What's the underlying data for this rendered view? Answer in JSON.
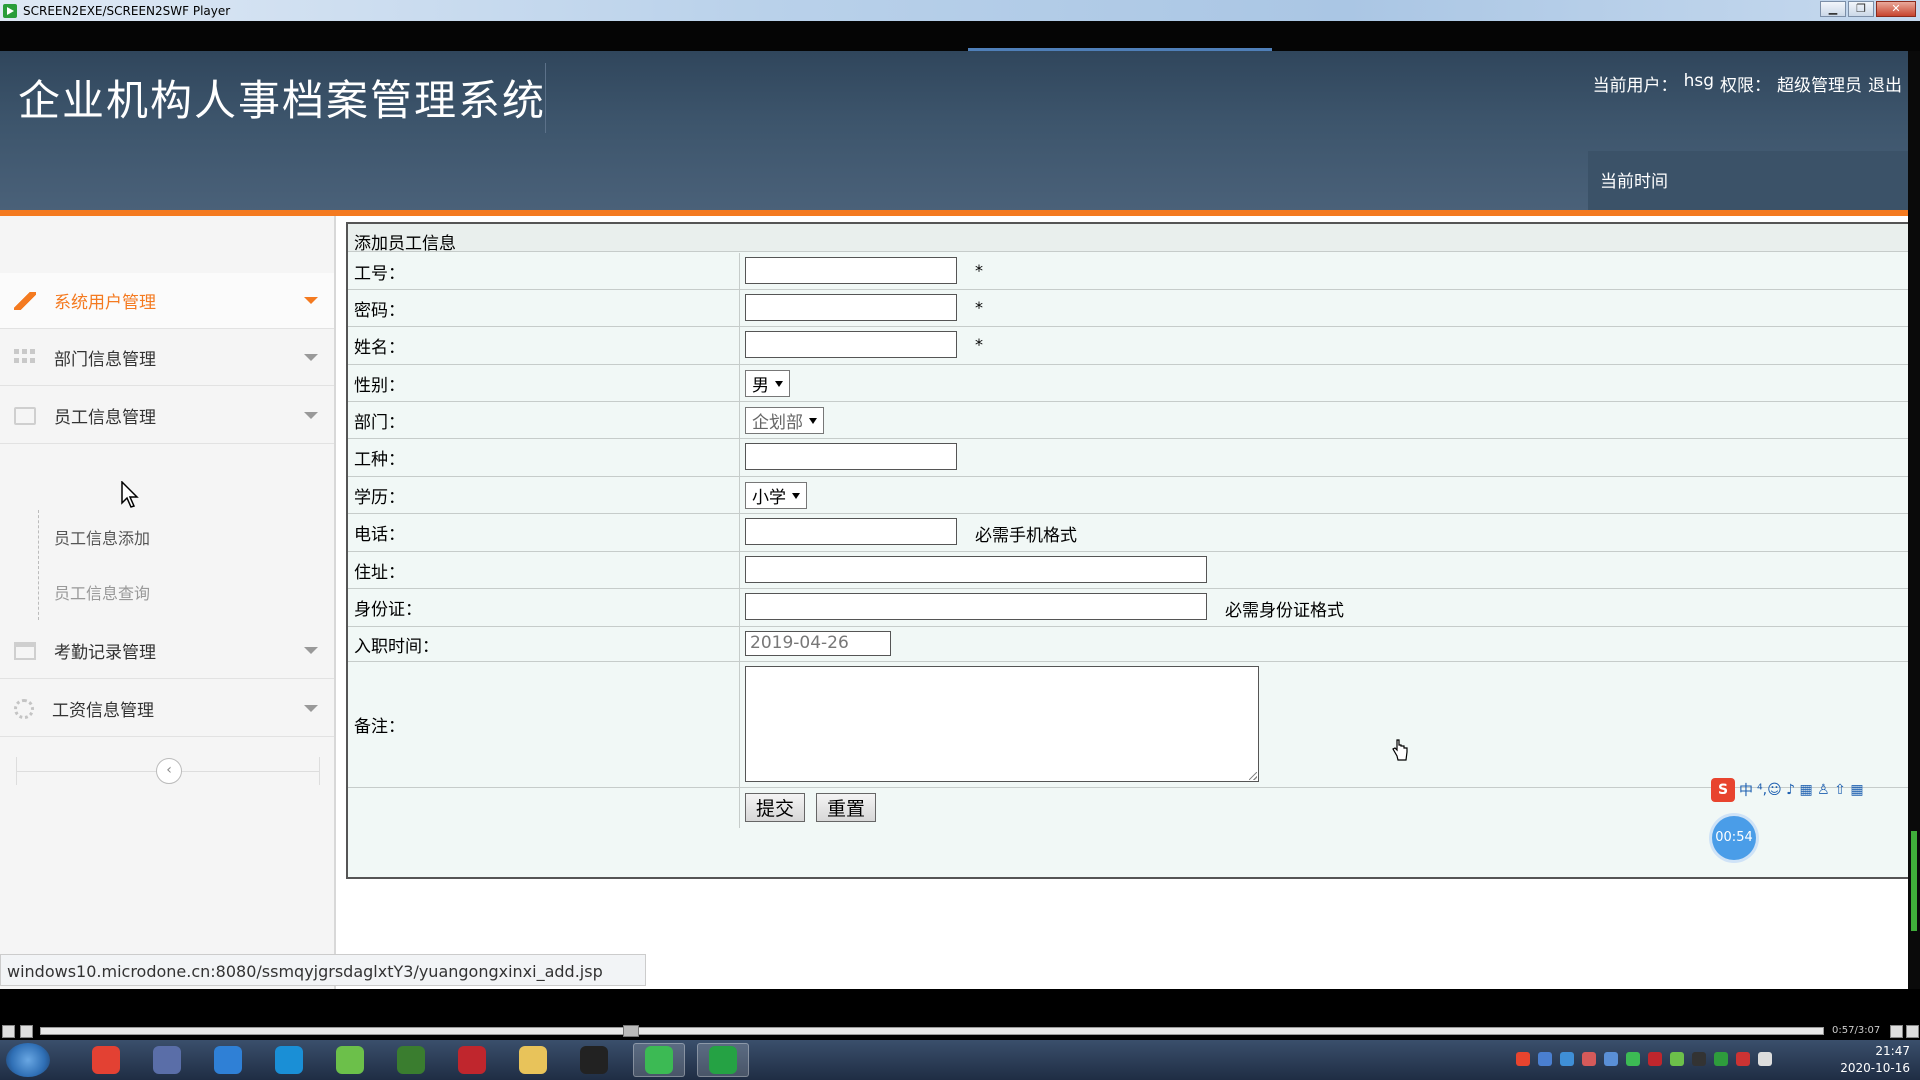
{
  "player": {
    "title": "SCREEN2EXE/SCREEN2SWF Player",
    "minimize": "▁",
    "restore": "❐",
    "close": "✕",
    "elapsed": "0:57/3:07"
  },
  "header": {
    "title": "企业机构人事档案管理系统",
    "current_user_label": "当前用户：",
    "current_user": "hsg",
    "permission_label": "权限：",
    "permission": "超级管理员",
    "logout": "退出",
    "current_time_label": "当前时间"
  },
  "sidebar": {
    "items": [
      {
        "label": "系统用户管理",
        "icon": "pencil-icon"
      },
      {
        "label": "部门信息管理",
        "icon": "grid-icon"
      },
      {
        "label": "员工信息管理",
        "icon": "card-icon"
      },
      {
        "label": "考勤记录管理",
        "icon": "calendar-icon"
      },
      {
        "label": "工资信息管理",
        "icon": "gear-icon"
      }
    ],
    "sub_items": [
      "员工信息添加",
      "员工信息查询"
    ],
    "collapse": "‹"
  },
  "form": {
    "title": "添加员工信息",
    "labels": {
      "emp_no": "工号：",
      "password": "密码：",
      "name": "姓名：",
      "gender": "性别：",
      "department": "部门：",
      "job_type": "工种：",
      "education": "学历：",
      "phone": "电话：",
      "address": "住址：",
      "id_card": "身份证：",
      "hire_date": "入职时间：",
      "remark": "备注："
    },
    "required_mark": "*",
    "gender_value": "男",
    "department_value": "企划部",
    "education_value": "小学",
    "phone_hint": "必需手机格式",
    "id_hint": "必需身份证格式",
    "hire_date_value": "2019-04-26",
    "submit": "提交",
    "reset": "重置"
  },
  "status_url": "windows10.microdone.cn:8080/ssmqyjgrsdaglxtY3/yuangongxinxi_add.jsp",
  "overlay": {
    "ime_logo": "S",
    "ime_mode": "中",
    "ime_icons": "⁴,☺ ♪ ▦ ♙ ⇧ ▦",
    "timer": "00:54"
  },
  "taskbar": {
    "clock_time": "21:47",
    "clock_date": "2020-10-16",
    "app_colors": [
      "#e34133",
      "#5a6ea8",
      "#2f80d6",
      "#1a8fd6",
      "#6cc04a",
      "#3a7d2f",
      "#c0262d",
      "#e8c35a",
      "#222222",
      "#3cba54",
      "#25a244"
    ]
  }
}
